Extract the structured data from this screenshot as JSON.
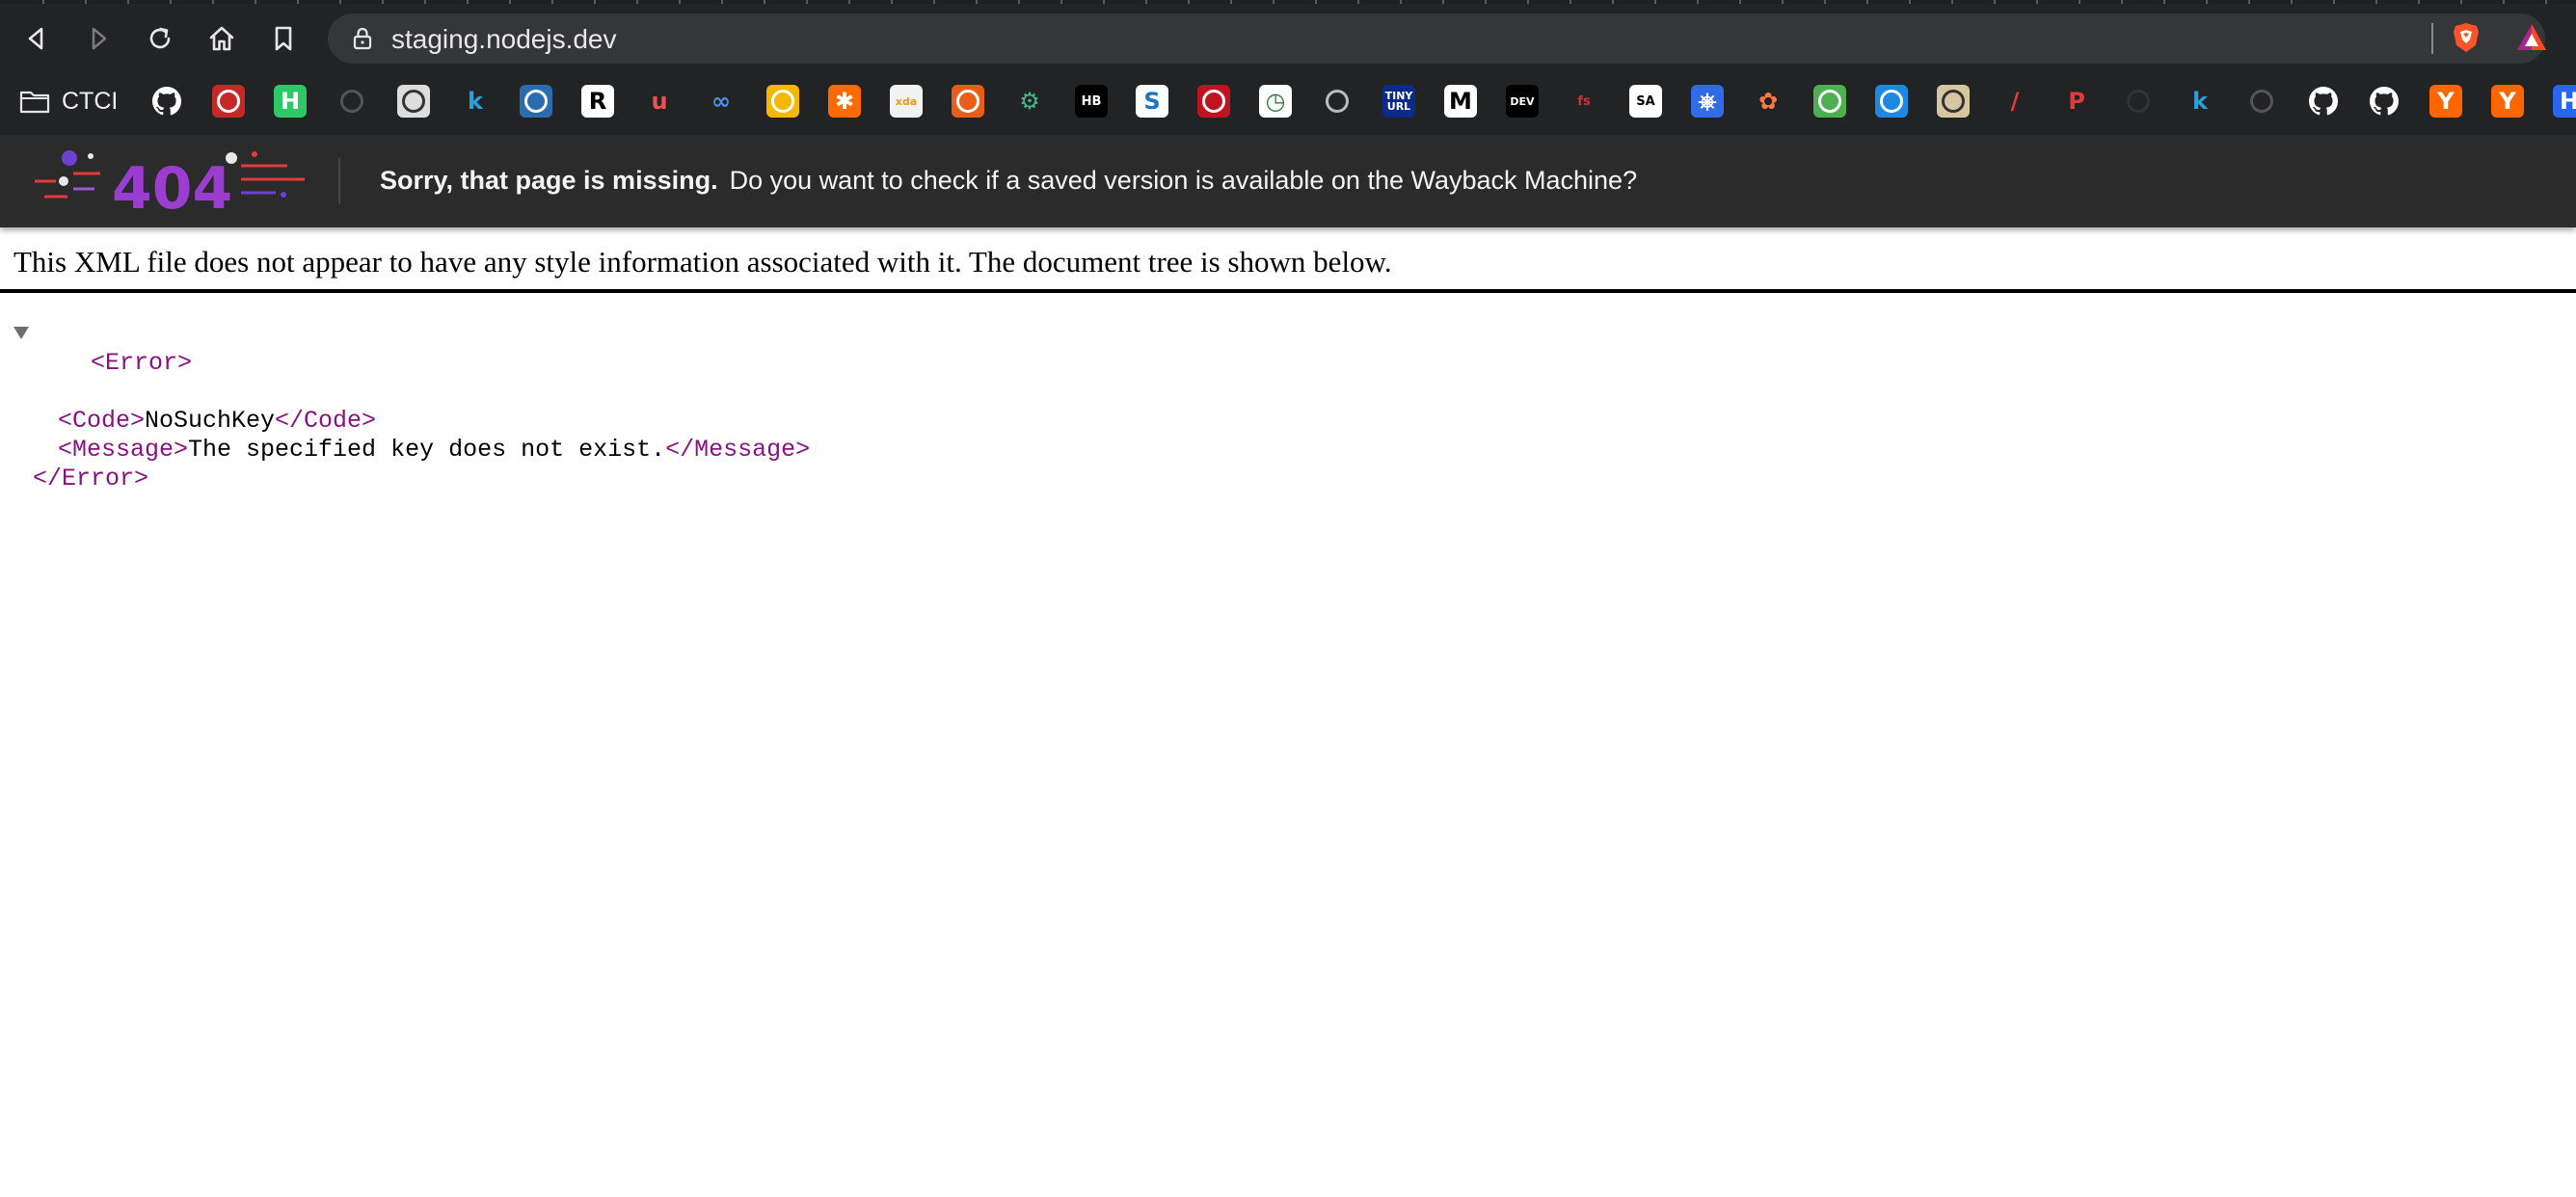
{
  "browser": {
    "url": "staging.nodejs.dev",
    "nav": {
      "back_icon": "back-icon",
      "forward_icon": "forward-icon",
      "reload_icon": "reload-icon",
      "home_icon": "home-icon",
      "bookmark_icon": "bookmark-icon"
    },
    "extensions": [
      "brave-shields-icon",
      "brave-rewards-icon"
    ]
  },
  "bookmarks": {
    "folder_label": "CTCI",
    "items": [
      {
        "name": "github-icon",
        "text": "",
        "bg": "#222324",
        "fg": "#ffffff"
      },
      {
        "name": "codepen-red-icon",
        "text": "",
        "bg": "#c62828",
        "fg": "#ffffff"
      },
      {
        "name": "hackerrank-icon",
        "text": "H",
        "bg": "#2ec866",
        "fg": "#ffffff"
      },
      {
        "name": "codepen-icon",
        "text": "",
        "bg": "#222324",
        "fg": "#555555"
      },
      {
        "name": "mascot-glasses-icon",
        "text": "",
        "bg": "#dddddd",
        "fg": "#333333"
      },
      {
        "name": "k-blue-icon",
        "text": "k",
        "bg": "#222324",
        "fg": "#2a9fd6"
      },
      {
        "name": "shield-blue-icon",
        "text": "",
        "bg": "#2b6cb0",
        "fg": "#ffffff"
      },
      {
        "name": "r-box-icon",
        "text": "R",
        "bg": "#ffffff",
        "fg": "#000000"
      },
      {
        "name": "udemy-icon",
        "text": "u",
        "bg": "#222324",
        "fg": "#ec5252"
      },
      {
        "name": "infinity-icon",
        "text": "∞",
        "bg": "#222324",
        "fg": "#4a90e2"
      },
      {
        "name": "cube-icon",
        "text": "",
        "bg": "#f5b800",
        "fg": "#ffffff"
      },
      {
        "name": "asterisk-orange-icon",
        "text": "✱",
        "bg": "#ff6a00",
        "fg": "#ffffff"
      },
      {
        "name": "xda-icon",
        "text": "xda",
        "bg": "#f2f2f2",
        "fg": "#f59714"
      },
      {
        "name": "orange-box-icon",
        "text": "",
        "bg": "#e85d1a",
        "fg": "#ffffff"
      },
      {
        "name": "gear-green-icon",
        "text": "⚙",
        "bg": "#222324",
        "fg": "#3dbb8a"
      },
      {
        "name": "hb-icon",
        "text": "HB",
        "bg": "#000000",
        "fg": "#ffffff"
      },
      {
        "name": "s-box-icon",
        "text": "S",
        "bg": "#ffffff",
        "fg": "#1b75bc"
      },
      {
        "name": "red-circle-icon",
        "text": "",
        "bg": "#c1121f",
        "fg": "#ffffff"
      },
      {
        "name": "clock-green-icon",
        "text": "◷",
        "bg": "#ffffff",
        "fg": "#2e7d32"
      },
      {
        "name": "octo-outline-icon",
        "text": "",
        "bg": "#222324",
        "fg": "#bbbbbb"
      },
      {
        "name": "tinyurl-icon",
        "text": "TINY URL",
        "bg": "#0b2a8a",
        "fg": "#ffffff"
      },
      {
        "name": "medium-icon",
        "text": "M",
        "bg": "#ffffff",
        "fg": "#000000"
      },
      {
        "name": "dev-icon",
        "text": "DEV",
        "bg": "#000000",
        "fg": "#ffffff"
      },
      {
        "name": "fs-icon",
        "text": "fs",
        "bg": "#222324",
        "fg": "#d32f2f"
      },
      {
        "name": "sa-icon",
        "text": "SA",
        "bg": "#ffffff",
        "fg": "#000000"
      },
      {
        "name": "kubernetes-icon",
        "text": "⎈",
        "bg": "#326ce5",
        "fg": "#ffffff"
      },
      {
        "name": "flower-orange-icon",
        "text": "✿",
        "bg": "#222324",
        "fg": "#ff7a45"
      },
      {
        "name": "leaf-green-icon",
        "text": "",
        "bg": "#4caf50",
        "fg": "#ffffff"
      },
      {
        "name": "globe-blue-icon",
        "text": "",
        "bg": "#1e88e5",
        "fg": "#ffffff"
      },
      {
        "name": "jenkins-icon",
        "text": "",
        "bg": "#d6c7a1",
        "fg": "#333333"
      },
      {
        "name": "pen-red-icon",
        "text": "/",
        "bg": "#222324",
        "fg": "#e53935"
      },
      {
        "name": "p-red-icon",
        "text": "P",
        "bg": "#222324",
        "fg": "#e53935"
      },
      {
        "name": "square-outline-icon",
        "text": "",
        "bg": "#222324",
        "fg": "#333333"
      },
      {
        "name": "k-blue-2-icon",
        "text": "k",
        "bg": "#222324",
        "fg": "#2a9fd6"
      },
      {
        "name": "bank-icon",
        "text": "",
        "bg": "#222324",
        "fg": "#555555"
      },
      {
        "name": "github-2-icon",
        "text": "",
        "bg": "#222324",
        "fg": "#ffffff"
      },
      {
        "name": "github-3-icon",
        "text": "",
        "bg": "#222324",
        "fg": "#ffffff"
      },
      {
        "name": "ycombinator-icon",
        "text": "Y",
        "bg": "#ff6600",
        "fg": "#ffffff"
      },
      {
        "name": "ycombinator-2-icon",
        "text": "Y",
        "bg": "#ff6600",
        "fg": "#ffffff"
      },
      {
        "name": "h-blue-icon",
        "text": "H",
        "bg": "#2965f1",
        "fg": "#ffffff"
      }
    ]
  },
  "wayback": {
    "logo_text": "404",
    "title": "Sorry, that page is missing.",
    "message": "Do you want to check if a saved version is available on the Wayback Machine?"
  },
  "xml": {
    "notice": "This XML file does not appear to have any style information associated with it. The document tree is shown below.",
    "lines": [
      {
        "open": "<Error>"
      },
      {
        "open": "<Code>",
        "text": "NoSuchKey",
        "close": "</Code>"
      },
      {
        "open": "<Message>",
        "text": "The specified key does not exist.",
        "close": "</Message>"
      },
      {
        "close": "</Error>"
      }
    ]
  }
}
